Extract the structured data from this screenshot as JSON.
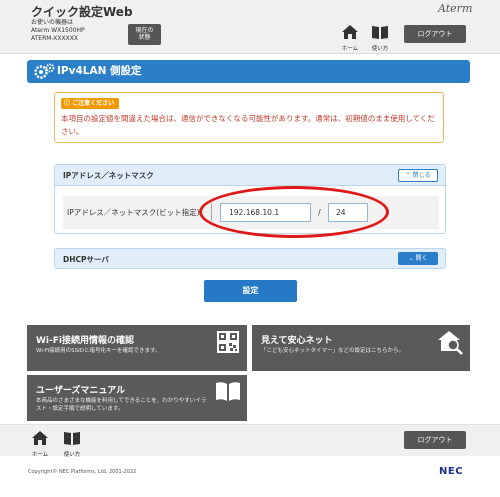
{
  "header": {
    "app_title": "クイック設定Web",
    "device_label": "お使いの機器は",
    "device_model": "Aterm WX1500HP",
    "device_serial": "ATERM-XXXXXX",
    "status_button": "現在の\n状態",
    "brand": "Aterm",
    "home_label": "ホーム",
    "help_label": "使い方",
    "logout_label": "ログアウト"
  },
  "page": {
    "title": "IPv4LAN 側設定"
  },
  "caution": {
    "badge": "ご注意ください",
    "text": "本項目の設定値を間違えた場合は、通信ができなくなる可能性があります。通常は、初期値のまま使用してください。"
  },
  "ip_section": {
    "title": "IPアドレス／ネットマスク",
    "toggle_label": "閉じる",
    "field_label": "IPアドレス／ネットマスク(ビット指定)",
    "ip_value": "192.168.10.1",
    "separator": "/",
    "mask_value": "24"
  },
  "dhcp_section": {
    "title": "DHCPサーバ",
    "toggle_label": "開く"
  },
  "apply_button": "設定",
  "cards": {
    "wifi": {
      "title": "Wi-Fi接続用情報の確認",
      "desc": "Wi-Fi接続用のSSIDと暗号化キーを確認できます。"
    },
    "net": {
      "title": "見えて安心ネット",
      "desc": "「こども安心ネットタイマー」などの設定はこちらから。"
    },
    "manual": {
      "title": "ユーザーズマニュアル",
      "desc": "本商品のさまざまな機能を利用してできることを、わかりやすいイラスト・設定手順で説明しています。"
    }
  },
  "footer": {
    "home_label": "ホーム",
    "help_label": "使い方",
    "logout_label": "ログアウト",
    "copyright": "Copyright© NEC Platforms, Ltd. 2001-2022",
    "logo": "NEC"
  },
  "colors": {
    "accent": "#2b7ec8",
    "caution": "#f09a00",
    "caution_text": "#c23a2a",
    "card": "#5a5a5a",
    "highlight": "#e01818"
  }
}
